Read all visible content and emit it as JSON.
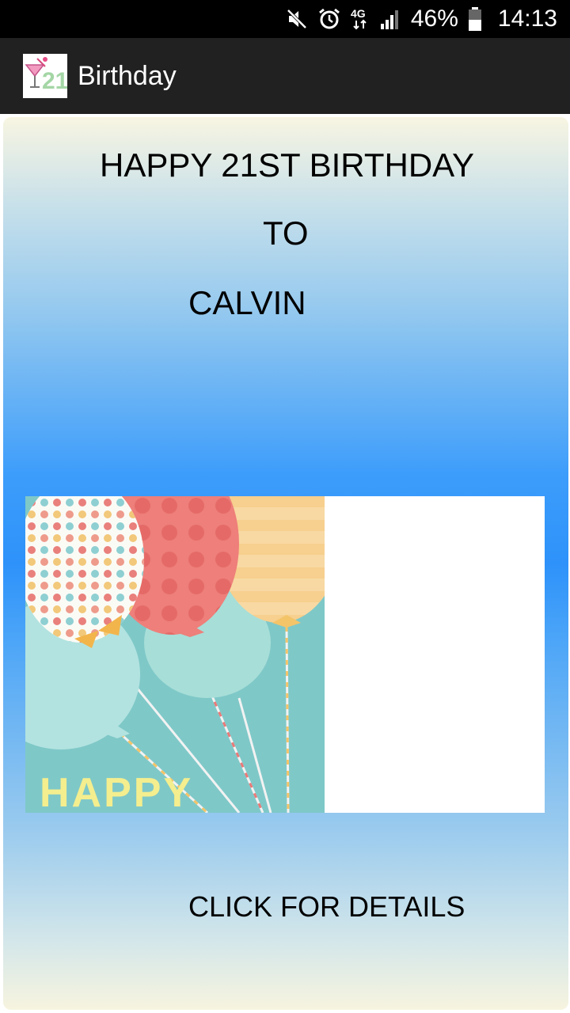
{
  "status_bar": {
    "battery_percent": "46%",
    "time": "14:13",
    "network_label": "4G",
    "icons": [
      "mute-icon",
      "alarm-icon",
      "network-4g-icon",
      "signal-icon",
      "battery-icon"
    ]
  },
  "action_bar": {
    "app_icon": "app-logo-21-icon",
    "title": "Birthday"
  },
  "card": {
    "line1": "HAPPY 21ST BIRTHDAY",
    "line2": "TO",
    "line3": "CALVIN",
    "image_text": "HAPPY",
    "link": "CLICK FOR DETAILS"
  },
  "colors": {
    "status_bar": "#000000",
    "action_bar": "#212121",
    "gradient_top": "#f8f5e2",
    "gradient_mid": "#2d92fa",
    "balloon_teal_bg": "#7fc8c8",
    "balloon_red": "#ef7f7a",
    "balloon_yellow": "#f9d59a",
    "balloon_mint": "#a7ded8"
  }
}
